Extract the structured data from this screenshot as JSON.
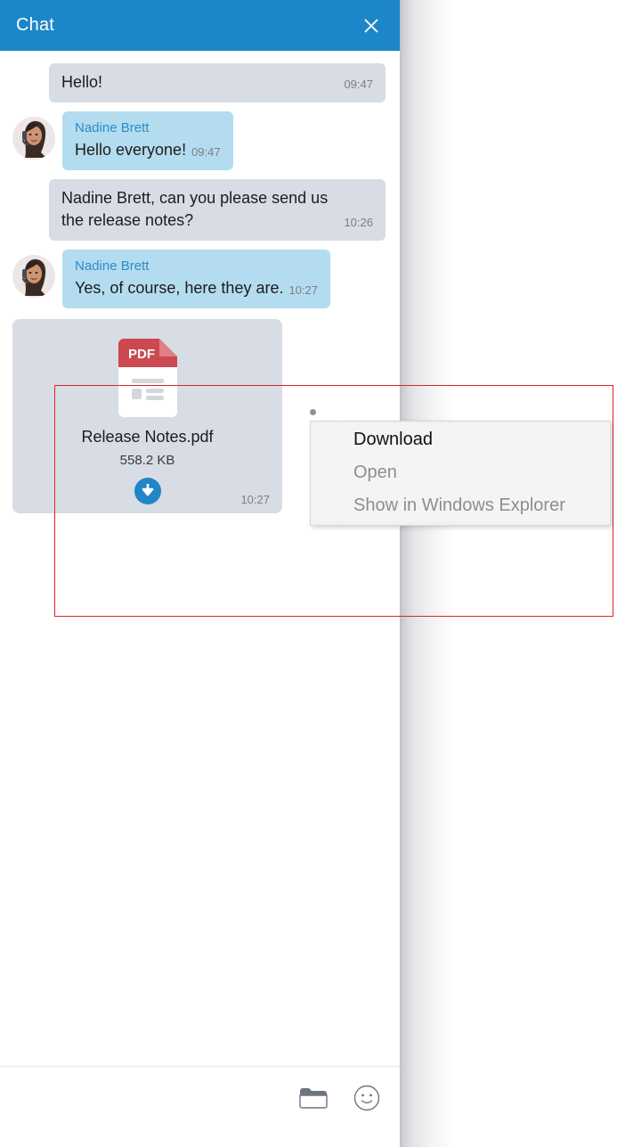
{
  "window": {
    "title": "Chat",
    "close_icon": "close-icon",
    "header_color": "#1b87c8"
  },
  "colors": {
    "accent": "#1b87c8",
    "bubble_incoming": "#b3dcf0",
    "bubble_outgoing": "#d8dce4",
    "sender_name": "#2e8bc8",
    "timestamp": "#7b7f87",
    "highlight_border": "#e02129",
    "pdf_red": "#cb4a51"
  },
  "messages": [
    {
      "id": "msg-hello",
      "side": "own",
      "style": "gray",
      "sender": null,
      "text": "Hello!",
      "time": "09:47",
      "avatar": null
    },
    {
      "id": "msg-hello-everyone",
      "side": "other",
      "style": "blue",
      "sender": "Nadine Brett",
      "text": "Hello everyone!",
      "time": "09:47",
      "avatar": "avatar-nadine"
    },
    {
      "id": "msg-request-notes",
      "side": "own",
      "style": "gray",
      "sender": null,
      "text": "Nadine Brett, can you please send us the release notes?",
      "time": "10:26",
      "avatar": null
    },
    {
      "id": "msg-yes-of-course",
      "side": "other",
      "style": "blue",
      "sender": "Nadine Brett",
      "text": "Yes, of course, here they are.",
      "time": "10:27",
      "avatar": "avatar-nadine"
    }
  ],
  "file_attachment": {
    "file_type_label": "PDF",
    "name": "Release Notes.pdf",
    "size": "558.2 KB",
    "time": "10:27",
    "download_icon": "download-icon",
    "icon": "pdf-file-icon"
  },
  "context_menu": {
    "items": [
      {
        "label": "Download",
        "state": "enabled"
      },
      {
        "label": "Open",
        "state": "disabled"
      },
      {
        "label": "Show in Windows Explorer",
        "state": "disabled"
      }
    ]
  },
  "composer": {
    "attach_icon": "folder-icon",
    "emoji_icon": "smiley-icon"
  }
}
